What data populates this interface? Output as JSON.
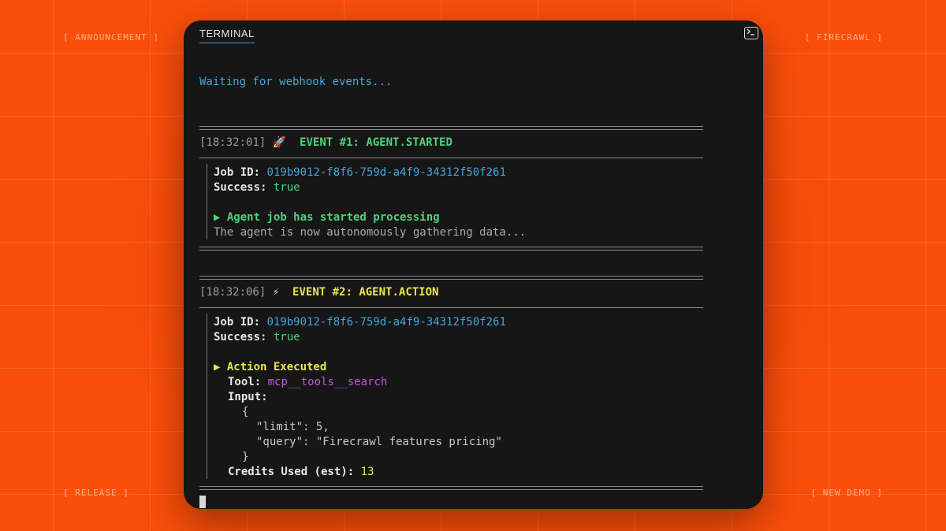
{
  "corners": {
    "top_left": "[ ANNOUNCEMENT ]",
    "top_right": "[ FIRECRAWL ]",
    "bottom_left": "[ RELEASE ]",
    "bottom_right": "[ NEW DEMO ]"
  },
  "terminal": {
    "tab_label": "TERMINAL",
    "icon": "terminal-icon",
    "waiting": "Waiting for webhook events...",
    "events": [
      {
        "timestamp": "[18:32:01]",
        "emoji": "🚀",
        "title": "EVENT #1: AGENT.STARTED",
        "job_label": "Job ID:",
        "job_id": "019b9012-f8f6-759d-a4f9-34312f50f261",
        "success_label": "Success:",
        "success_value": "true",
        "heading": "▶ Agent job has started processing",
        "detail": "The agent is now autonomously gathering data..."
      },
      {
        "timestamp": "[18:32:06]",
        "emoji": "⚡",
        "title": "EVENT #2: AGENT.ACTION",
        "job_label": "Job ID:",
        "job_id": "019b9012-f8f6-759d-a4f9-34312f50f261",
        "success_label": "Success:",
        "success_value": "true",
        "heading": "▶ Action Executed",
        "tool_label": "Tool:",
        "tool_value": "mcp__tools__search",
        "input_label": "Input:",
        "json_open": "{",
        "json_limit": "\"limit\": 5,",
        "json_query": "\"query\": \"Firecrawl features pricing\"",
        "json_close": "}",
        "credits_label": "Credits Used (est):",
        "credits_value": "13"
      }
    ]
  },
  "colors": {
    "background": "#fa4f0a",
    "terminal_bg": "#161616",
    "cyan": "#43a6dc",
    "green": "#4fd27a",
    "yellow": "#e8e84a",
    "magenta": "#c458d6"
  }
}
